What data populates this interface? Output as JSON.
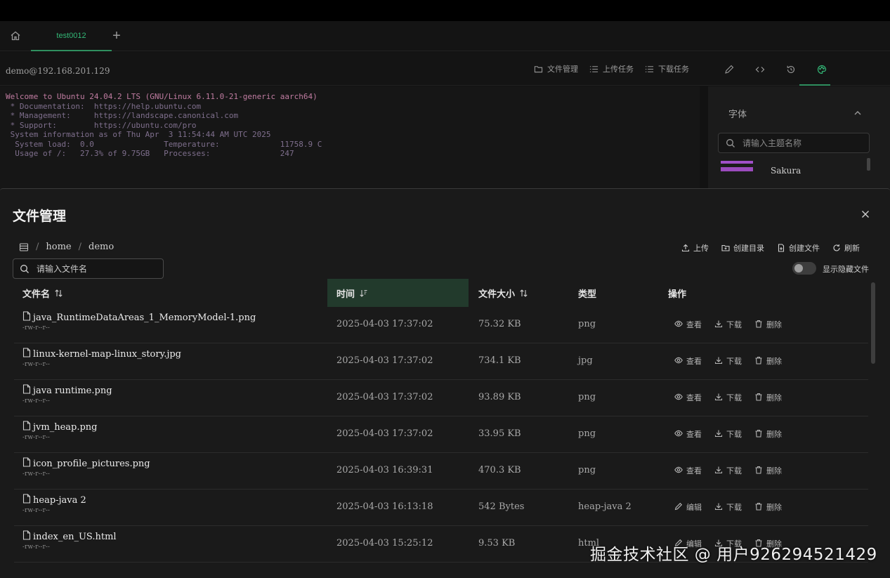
{
  "tabs": {
    "home_icon": "home-icon",
    "active_tab_label": "test0012",
    "add_tab_icon": "plus-icon"
  },
  "session": {
    "host": "demo@192.168.201.129",
    "actions": [
      {
        "label": "文件管理",
        "icon": "folder-icon"
      },
      {
        "label": "上传任务",
        "icon": "list-icon"
      },
      {
        "label": "下载任务",
        "icon": "list-icon"
      }
    ],
    "icons": [
      "edit-icon",
      "code-icon",
      "history-icon",
      "theme-icon"
    ]
  },
  "terminal": {
    "lines": [
      "Welcome to Ubuntu 24.04.2 LTS (GNU/Linux 6.11.0-21-generic aarch64)",
      "",
      " * Documentation:  https://help.ubuntu.com",
      " * Management:     https://landscape.canonical.com",
      " * Support:        https://ubuntu.com/pro",
      "",
      " System information as of Thu Apr  3 11:54:44 AM UTC 2025",
      "",
      "  System load:  0.0               Temperature:             11758.9 C",
      "  Usage of /:   27.3% of 9.75GB   Processes:               247"
    ]
  },
  "theme_panel": {
    "title": "字体",
    "search_placeholder": "请输入主题名称",
    "theme_name": "Sakura"
  },
  "file_manager": {
    "title": "文件管理",
    "breadcrumb": [
      "home",
      "demo"
    ],
    "actions": [
      {
        "label": "上传",
        "icon": "upload-icon"
      },
      {
        "label": "创建目录",
        "icon": "folder-plus-icon"
      },
      {
        "label": "创建文件",
        "icon": "file-plus-icon"
      },
      {
        "label": "刷新",
        "icon": "refresh-icon"
      }
    ],
    "search_placeholder": "请输入文件名",
    "show_hidden_label": "显示隐藏文件",
    "show_hidden": false,
    "columns": {
      "name": "文件名",
      "time": "时间",
      "size": "文件大小",
      "type": "类型",
      "ops": "操作"
    },
    "rows": [
      {
        "name": "java_RuntimeDataAreas_1_MemoryModel-1.png",
        "perm": "-rw-r--r--",
        "time": "2025-04-03 17:37:02",
        "size": "75.32 KB",
        "type": "png",
        "first_op": "查看",
        "first_icon": "eye-icon"
      },
      {
        "name": "linux-kernel-map-linux_story.jpg",
        "perm": "-rw-r--r--",
        "time": "2025-04-03 17:37:02",
        "size": "734.1 KB",
        "type": "jpg",
        "first_op": "查看",
        "first_icon": "eye-icon"
      },
      {
        "name": "java runtime.png",
        "perm": "-rw-r--r--",
        "time": "2025-04-03 17:37:02",
        "size": "93.89 KB",
        "type": "png",
        "first_op": "查看",
        "first_icon": "eye-icon"
      },
      {
        "name": "jvm_heap.png",
        "perm": "-rw-r--r--",
        "time": "2025-04-03 17:37:02",
        "size": "33.95 KB",
        "type": "png",
        "first_op": "查看",
        "first_icon": "eye-icon"
      },
      {
        "name": "icon_profile_pictures.png",
        "perm": "-rw-r--r--",
        "time": "2025-04-03 16:39:31",
        "size": "470.3 KB",
        "type": "png",
        "first_op": "查看",
        "first_icon": "eye-icon"
      },
      {
        "name": "heap-java 2",
        "perm": "-rw-r--r--",
        "time": "2025-04-03 16:13:18",
        "size": "542 Bytes",
        "type": "heap-java 2",
        "first_op": "编辑",
        "first_icon": "pencil-icon"
      },
      {
        "name": "index_en_US.html",
        "perm": "-rw-r--r--",
        "time": "2025-04-03 15:25:12",
        "size": "9.53 KB",
        "type": "html",
        "first_op": "编辑",
        "first_icon": "pencil-icon"
      }
    ],
    "download_label": "下载",
    "delete_label": "删除"
  },
  "watermark": "掘金技术社区 @ 用户926294521429"
}
